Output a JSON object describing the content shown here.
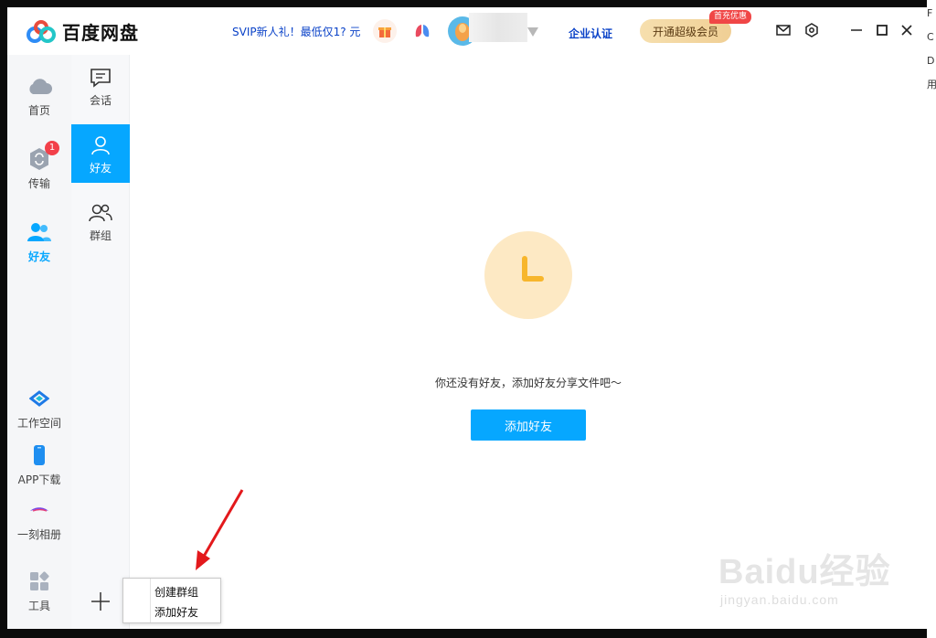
{
  "app": {
    "title": "百度网盘"
  },
  "header": {
    "promo_text": "SVIP新人礼！最低仅1? 元",
    "enterprise_label": "企业认证",
    "vip_button_label": "开通超级会员",
    "vip_tag": "首充优惠"
  },
  "nav": {
    "items": [
      {
        "label": "首页",
        "icon": "cloud-icon"
      },
      {
        "label": "传输",
        "icon": "transfer-icon",
        "badge": "1"
      },
      {
        "label": "好友",
        "icon": "friends-icon",
        "active": true
      },
      {
        "label": "工作空间",
        "icon": "workspace-icon"
      },
      {
        "label": "APP下载",
        "icon": "phone-icon"
      },
      {
        "label": "一刻相册",
        "icon": "album-icon"
      },
      {
        "label": "工具",
        "icon": "tools-icon"
      }
    ]
  },
  "subnav": {
    "items": [
      {
        "label": "会话",
        "icon": "chat-icon"
      },
      {
        "label": "好友",
        "icon": "person-icon",
        "active": true
      },
      {
        "label": "群组",
        "icon": "group-icon"
      }
    ]
  },
  "main": {
    "empty_text": "你还没有好友，添加好友分享文件吧～",
    "add_friend_button": "添加好友"
  },
  "popup_menu": {
    "items": [
      "创建群组",
      "添加好友"
    ]
  },
  "watermark": {
    "big": "Baidu经验",
    "small": "jingyan.baidu.com"
  },
  "edge_strip_text": [
    "F",
    "C",
    "D",
    "用"
  ],
  "colors": {
    "accent": "#06a7ff",
    "badge": "#f2404a",
    "annotation_arrow": "#e3191c"
  }
}
